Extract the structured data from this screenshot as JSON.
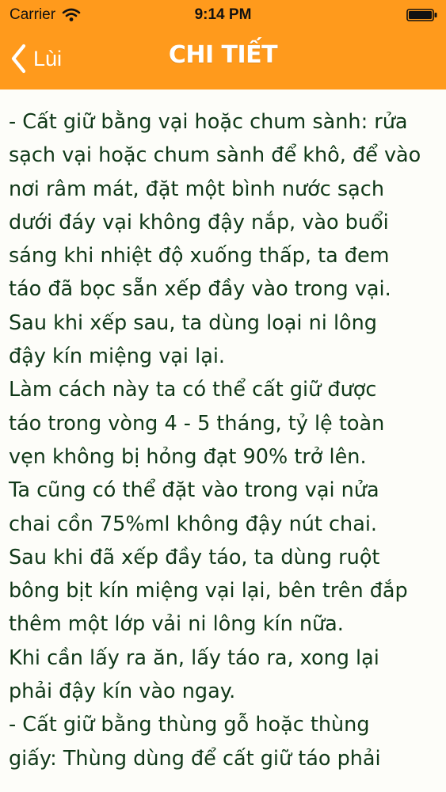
{
  "status_bar": {
    "carrier": "Carrier",
    "time": "9:14 PM",
    "wifi_icon": "wifi-icon",
    "battery_icon": "battery-icon"
  },
  "navbar": {
    "back_label": "Lùi",
    "back_icon": "chevron-left-icon",
    "title": "CHI TIẾT"
  },
  "colors": {
    "nav_background": "#ff9a1c",
    "text": "#103818",
    "page_background": "#fdfdf9"
  },
  "content_lines": [
    "- Cất giữ bằng vại hoặc chum sành: rửa",
    "sạch vại hoặc chum sành để khô, để vào",
    "nơi râm mát, đặt một bình nước sạch",
    "dưới đáy vại không đậy nắp, vào buổi",
    "sáng khi nhiệt độ xuống thấp, ta đem",
    "táo đã bọc sẵn xếp đầy vào trong vại.",
    "Sau khi xếp sau, ta dùng loại ni lông",
    "đậy kín miệng vại lại.",
    "Làm cách này ta có thể cất giữ được",
    "táo trong vòng 4 - 5 tháng, tỷ lệ toàn",
    "vẹn không bị hỏng đạt 90% trở lên.",
    "Ta cũng có thể đặt vào trong vại nửa",
    "chai cồn 75%ml không đậy nút chai.",
    "Sau khi đã xếp đầy táo, ta dùng ruột",
    "bông bịt kín miệng vại lại, bên trên đắp",
    "thêm một lớp vải ni lông kín nữa.",
    "Khi cần lấy ra ăn, lấy táo ra, xong lại",
    "phải đậy kín vào ngay.",
    "- Cất giữ bằng thùng gỗ hoặc thùng",
    "giấy: Thùng dùng để  cất giữ táo phải"
  ]
}
